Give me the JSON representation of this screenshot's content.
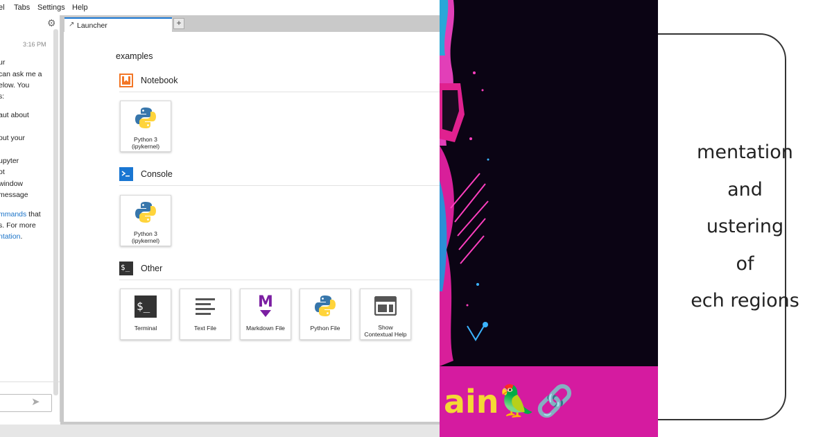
{
  "menubar": {
    "items": [
      "el",
      "Tabs",
      "Settings",
      "Help"
    ]
  },
  "chat": {
    "time": "3:16 PM",
    "lines": [
      "ur",
      "can ask me a",
      "elow. You",
      "s:",
      "aut about",
      "out your",
      "upyter",
      "ot",
      "window",
      "message"
    ],
    "cmd_line_link": "mmands",
    "cmd_line_rest": " that",
    "more_line": "s. For more",
    "doc_link": "ntation",
    "doc_rest": "."
  },
  "tabs": {
    "launcher_label": "Launcher",
    "add_label": "+"
  },
  "launcher": {
    "title": "examples",
    "sections": [
      {
        "label": "Notebook",
        "cards": [
          "Python 3\n(ipykernel)"
        ]
      },
      {
        "label": "Console",
        "cards": [
          "Python 3\n(ipykernel)"
        ]
      },
      {
        "label": "Other",
        "cards": [
          "Terminal",
          "Text File",
          "Markdown File",
          "Python File",
          "Show\nContextual Help"
        ]
      }
    ]
  },
  "art": {
    "banner_text": "ain",
    "banner_emoji": "🦜🔗",
    "colors": {
      "banner": "#d51ba0",
      "banner_text": "#f4d934",
      "background": "#0b0414"
    }
  },
  "box": {
    "lines": [
      "mentation",
      "and",
      "ustering",
      "of",
      "ech regions"
    ]
  },
  "colors": {
    "accent": "#1976d2",
    "notebook_icon": "#f37626",
    "console_icon": "#1976d2",
    "markdown_icon": "#7b1fa2"
  }
}
